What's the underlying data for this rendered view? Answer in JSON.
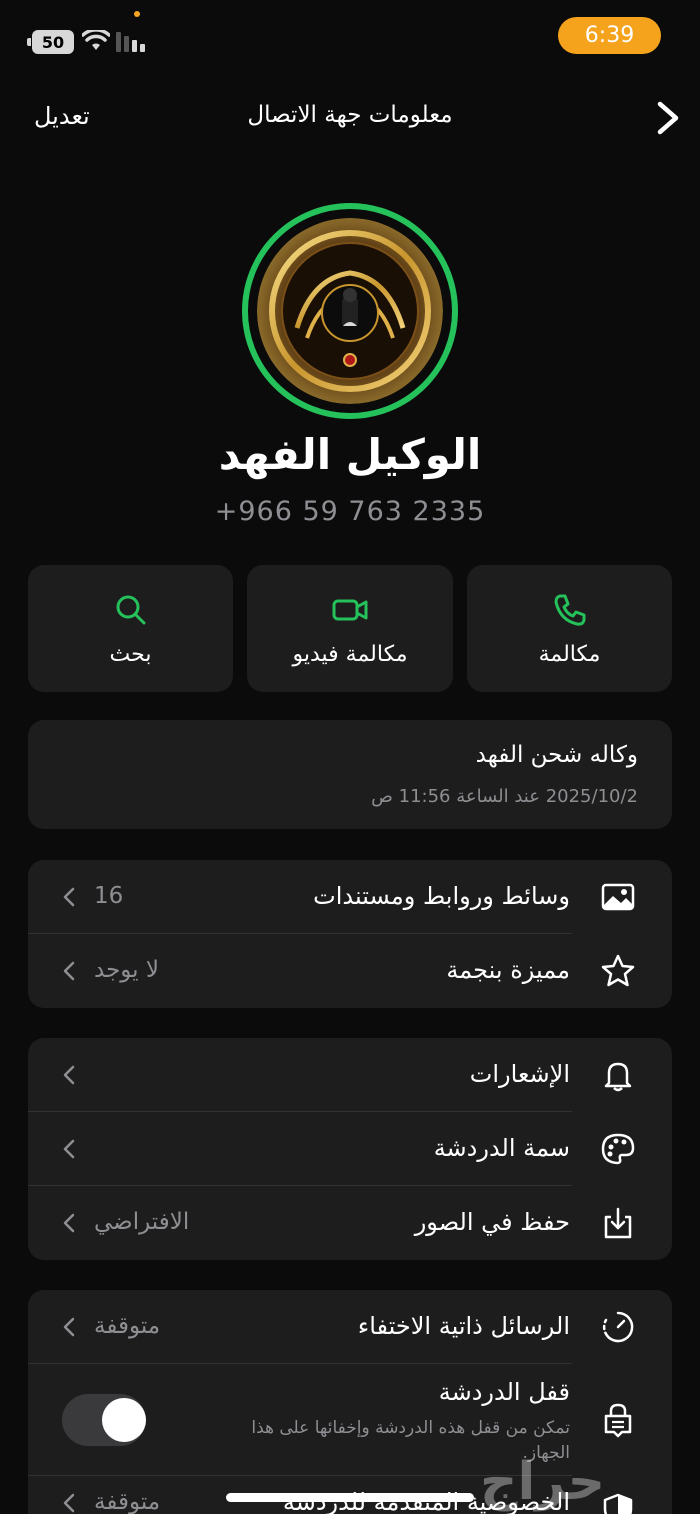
{
  "status_bar": {
    "battery": "50",
    "time": "6:39"
  },
  "nav": {
    "edit_label": "تعديل",
    "title": "معلومات جهة الاتصال"
  },
  "profile": {
    "name": "الوكيل الفهد",
    "phone": "+966 59 763 2335",
    "avatar_text": {
      "top": "وكالة الفهد",
      "bottom": "تواصل",
      "left_id": "ID: 99999997",
      "right_id": "ID: 99999997"
    }
  },
  "actions": {
    "search": "بحث",
    "video_call": "مكالمة فيديو",
    "call": "مكالمة"
  },
  "about": {
    "text": "وكاله شحن الفهد",
    "date": "2025/10/2 عند الساعة 11:56 ص"
  },
  "media_section": {
    "media": {
      "label": "وسائط وروابط ومستندات",
      "value": "16"
    },
    "starred": {
      "label": "مميزة بنجمة",
      "value": "لا يوجد"
    }
  },
  "settings_section": {
    "notifications": {
      "label": "الإشعارات"
    },
    "chat_theme": {
      "label": "سمة الدردشة"
    },
    "save_to_photos": {
      "label": "حفظ في الصور",
      "value": "الافتراضي"
    }
  },
  "privacy_section": {
    "disappearing": {
      "label": "الرسائل ذاتية الاختفاء",
      "value": "متوقفة"
    },
    "chat_lock": {
      "label": "قفل الدردشة",
      "description": "تمكن من قفل هذه الدردشة وإخفائها على هذا الجهاز.",
      "enabled": true
    },
    "advanced_privacy": {
      "label": "الخصوصية المتقدمة للدردشة",
      "value": "متوقفة"
    }
  },
  "watermark": "حراج",
  "colors": {
    "accent_green": "#25c15a",
    "time_pill": "#f5a21c",
    "card_bg": "#1d1d1d",
    "secondary_text": "#8e8e93"
  }
}
